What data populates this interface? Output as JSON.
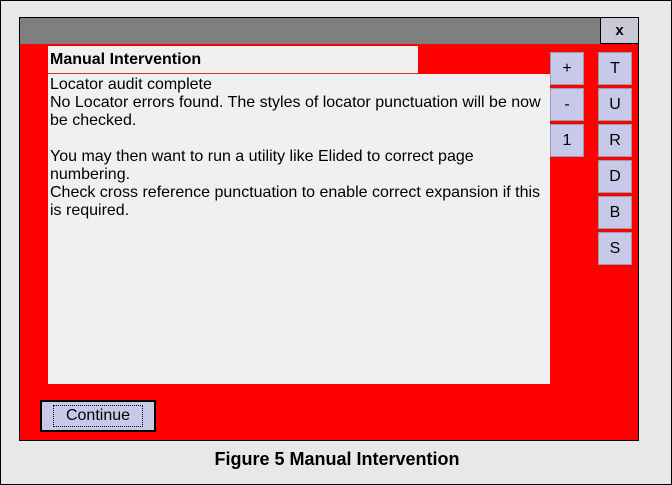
{
  "window": {
    "close_label": "x",
    "message": {
      "title": "Manual Intervention",
      "lines": [
        "Locator audit complete",
        "No Locator errors found. The styles of locator punctuation will be now be checked.",
        "",
        "You may then want to run a utility like Elided to correct page numbering.",
        "Check cross reference punctuation to enable correct expansion if this is required."
      ]
    },
    "zoom_buttons": {
      "plus": "+",
      "minus": "-",
      "one": "1"
    },
    "side_buttons": [
      "T",
      "U",
      "R",
      "D",
      "B",
      "S"
    ],
    "continue_label": "Continue"
  },
  "caption": "Figure 5 Manual Intervention",
  "colors": {
    "background": "#ff0000",
    "titlebar": "#7f7f7f",
    "button": "#c8c8e8"
  }
}
